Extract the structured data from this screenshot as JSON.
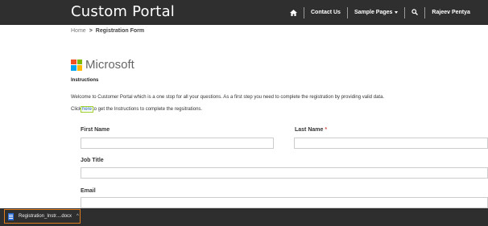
{
  "header": {
    "brand": "Custom Portal",
    "nav": {
      "contact": "Contact Us",
      "sample_pages": "Sample Pages",
      "user": "Rajeev Pentya"
    }
  },
  "breadcrumb": {
    "home": "Home",
    "separator": ">",
    "current": "Registration Form"
  },
  "logo": {
    "text": "Microsoft",
    "colors": [
      "#f25022",
      "#7fba00",
      "#00a4ef",
      "#ffb900"
    ]
  },
  "instructions": {
    "title": "Instructions",
    "text": "Welcome to Customer Portal which is a one stop for all your questions. As a first step you need to complete the registration by providing valid data.",
    "click_prefix": "Click",
    "link": "here",
    "click_suffix": "to get the Instructions to complete the regsitrations."
  },
  "form": {
    "first_name_label": "First Name",
    "last_name_label": "Last Name",
    "required_mark": "*",
    "job_title_label": "Job Title",
    "email_label": "Email",
    "first_name_value": "",
    "last_name_value": "",
    "job_title_value": "",
    "email_value": ""
  },
  "download": {
    "filename": "Registration_Instr....docx",
    "chevron": "^"
  }
}
